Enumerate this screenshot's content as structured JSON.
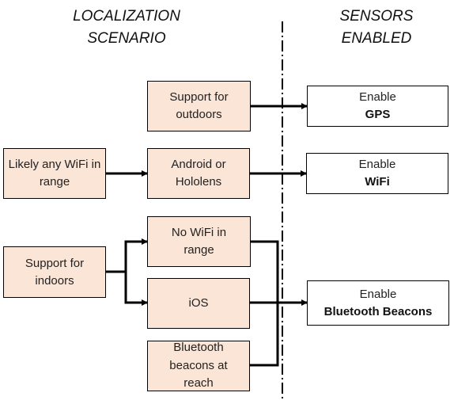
{
  "headers": {
    "left_line1": "LOCALIZATION",
    "left_line2": "SCENARIO",
    "right_line1": "SENSORS",
    "right_line2": "ENABLED"
  },
  "scenarios": {
    "outdoors": "Support for outdoors",
    "wifi_range": "Likely any WiFi in range",
    "android": "Android or Hololens",
    "indoors": "Support for indoors",
    "no_wifi": "No WiFi in range",
    "ios": "iOS",
    "beacons": "Bluetooth beacons at reach"
  },
  "sensors": {
    "gps": {
      "action": "Enable",
      "name": "GPS"
    },
    "wifi": {
      "action": "Enable",
      "name": "WiFi"
    },
    "bluetooth": {
      "action": "Enable",
      "name": "Bluetooth Beacons"
    }
  },
  "colors": {
    "scenario_fill": "#fbe5d6",
    "sensor_fill": "#ffffff",
    "line": "#000000"
  }
}
